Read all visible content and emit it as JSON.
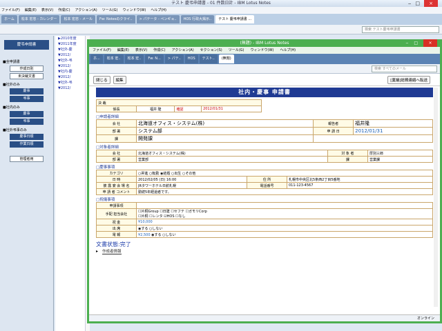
{
  "bg": {
    "title": "テスト 慶弔申請書 - 01 件数日計 - IBM Lotus Notes",
    "menu": [
      "ファイル(F)",
      "編集(E)",
      "表示(V)",
      "作成(C)",
      "アクション(A)",
      "ツール(G)",
      "ウィンドウ(W)",
      "ヘルプ(H)"
    ],
    "tabs": [
      "ホーム",
      "松本 宏忠 - カレンダー",
      "松本 宏忠 - メール",
      "Fw: Notesのクライ..",
      "> パテータ - ペンギョ..",
      "HOS 行政大掲示..",
      "テスト 慶弔申請書 ..."
    ],
    "search": "検索 テスト慶弔申請書",
    "db_title": "慶弔申請書",
    "nav": [
      {
        "h": "■全申請書",
        "items": [
          "作成日別",
          "未決裁文書"
        ]
      },
      {
        "h": "■社外のみ",
        "items": [
          "慶事",
          "弔事"
        ]
      },
      {
        "h": "■社内のみ",
        "items": [
          "慶事",
          "弔事"
        ]
      },
      {
        "h": "■社外弔事のみ",
        "items": [
          "慶事日順",
          "作業日順"
        ]
      }
    ],
    "nav_footer": "管理者用",
    "tree": [
      "▶2010年度",
      "▼2011年度",
      "▼社外-慶",
      "▼2012/",
      "▼社外-弔",
      "▼2012/",
      "▼社内-慶",
      "▼2012/",
      "▼社外-弔",
      "▼2012/"
    ]
  },
  "fw": {
    "title": "(無題) - IBM Lotus Notes",
    "menu": [
      "ファイル(F)",
      "編集(E)",
      "表示(V)",
      "作成(C)",
      "アクション(A)",
      "セクション(S)",
      "ツール(G)",
      "ウィンドウ(W)",
      "ヘルプ(H)"
    ],
    "tabs": [
      "ホ...",
      "松本 宏..",
      "松本 宏..",
      "Fw: N...",
      "> パテ..",
      "HOS",
      "テスト..",
      "(無題)"
    ],
    "search": "検索 すべてのメール",
    "close": "閉じる",
    "edit": "編集",
    "link": "[稟議]総務連絡へ転送",
    "doc": {
      "title": "社内・慶事 申請書",
      "kessai": "決 裁",
      "kacho": "係長",
      "approver": "福井 隆",
      "confirm": "確認",
      "date": "2012/01/31",
      "sec1": "□申請者詳細",
      "company_l": "会 社",
      "company": "北海道オフィス・システム(株)",
      "applicant_l": "報告者",
      "applicant": "福井隆",
      "dept_l": "部 署",
      "dept": "システム部",
      "appdate_l": "申 請 日",
      "appdate": "2012/01/31",
      "section_l": "課",
      "section": "開発課",
      "sec2": "□対象者詳細",
      "t_company_l": "会 社",
      "t_company": "北海道オフィス・システム(株)",
      "t_person_l": "対 象 者",
      "t_person": "厚別三郎",
      "t_dept_l": "部 署",
      "t_dept": "営業部",
      "t_section_l": "課",
      "t_section": "営業課",
      "sec3": "□慶事事項",
      "cat_l": "カテゴリ",
      "cats": [
        "昇進",
        "転勤",
        "結婚",
        "出生",
        "その他"
      ],
      "dt_l": "日 時",
      "dt": "2012/02/05 (日) 16:00",
      "addr_l": "住 所",
      "addr": "札幌市中央区北5条西2丁目5番地",
      "venue_l": "披 露 宴\n会 場 名",
      "venue": "JRタワーホテル日航札幌",
      "tel_l": "電話番号",
      "tel": "011-123-4567",
      "comment_l": "申 請 者\nコメント",
      "comment": "勤続5年経過者です。",
      "sec4": "□祝儀事項",
      "req_l": "申請事項",
      "sender_l": "手配\n担当会社",
      "checks1": [
        "片桐Group",
        "日建",
        "セフテ",
        "ガモリCorp"
      ],
      "checks2": [
        "片桐",
        "レンタ",
        "HOS",
        "なし"
      ],
      "money_l": "祝 金",
      "money": "¥10,000",
      "attend_l": "出 席",
      "attend": [
        "する",
        "しない"
      ],
      "tele_l": "電 報",
      "tele": "¥2,500",
      "tele_opt": [
        "する",
        "しない"
      ],
      "status": "文書状態:完了",
      "history": "作成者情報"
    },
    "statusbar": "オンライン"
  },
  "colors": {
    "accent": "#4caf50",
    "title_bar": "#1f3a93"
  }
}
